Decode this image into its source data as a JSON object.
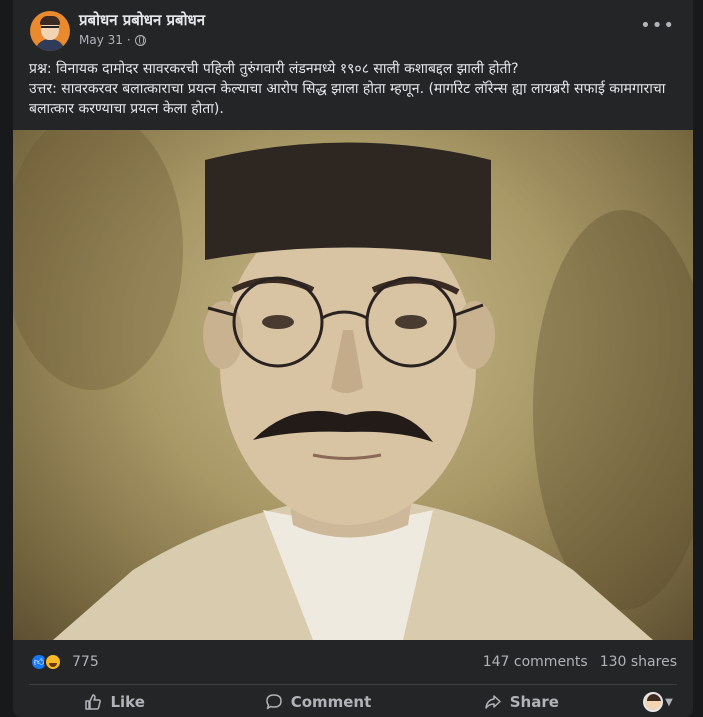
{
  "post": {
    "author": "प्रबोधन प्रबोधन प्रबोधन",
    "date": "May 31",
    "separator": "·",
    "privacy_icon": "globe-icon",
    "more_icon": "•••",
    "question": "प्रश्न: विनायक दामोदर सावरकरची पहिली तुरुंगवारी लंडनमध्ये १९०८ साली कशाबद्दल झाली होती?",
    "answer": "उत्तर: सावरकरवर बलात्काराचा प्रयत्न केल्याचा आरोप सिद्ध झाला होता म्हणून. (मार्गारेट लॉरेन्स ह्या लायब्ररी सफाई कामगाराचा बलात्कार करण्याचा प्रयत्न केला होता)."
  },
  "stats": {
    "reaction_count": "775",
    "comments": "147 comments",
    "shares": "130 shares",
    "reaction_icons": [
      "like-reaction-icon",
      "haha-reaction-icon"
    ]
  },
  "actions": {
    "like": "Like",
    "comment": "Comment",
    "share": "Share"
  },
  "colors": {
    "card_bg": "#242526",
    "page_bg": "#18191a",
    "text_primary": "#e4e6eb",
    "text_secondary": "#b0b3b8",
    "like_blue": "#1877f2"
  }
}
